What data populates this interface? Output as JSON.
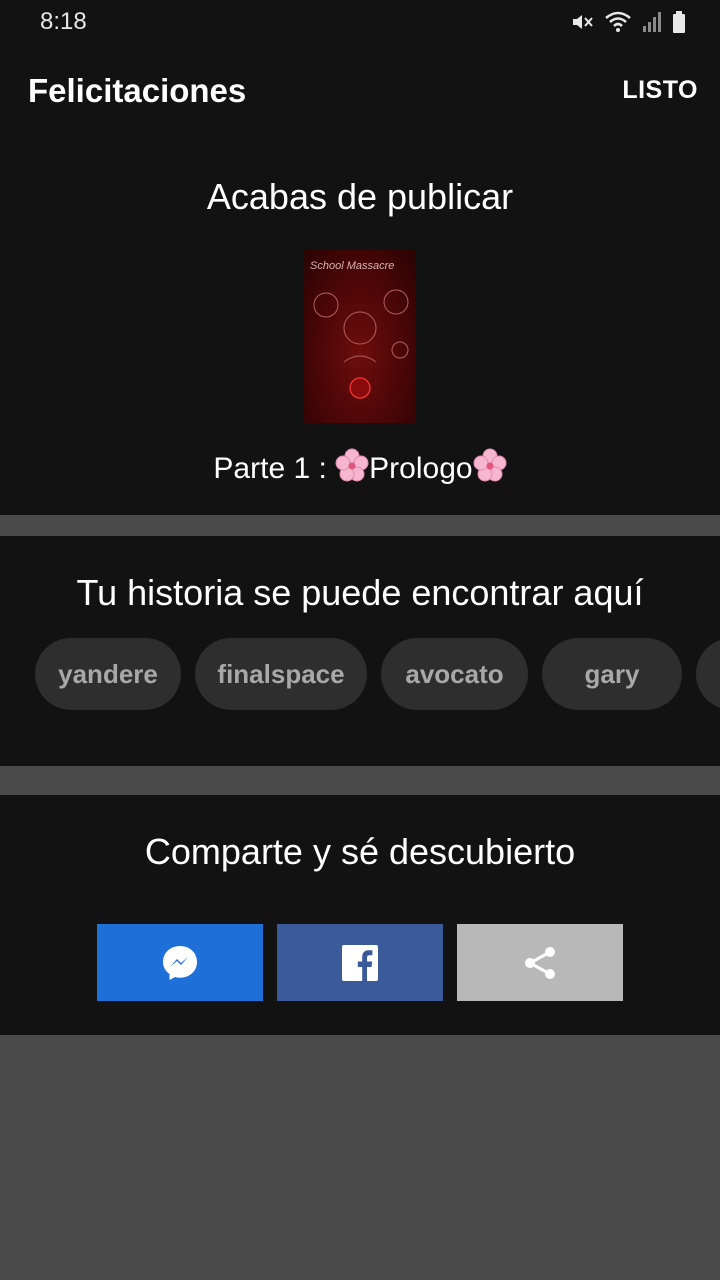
{
  "status_bar": {
    "time": "8:18",
    "icons": [
      "mute-icon",
      "wifi-icon",
      "signal-icon",
      "battery-icon"
    ]
  },
  "app_bar": {
    "title": "Felicitaciones",
    "done_label": "LISTO"
  },
  "published": {
    "heading": "Acabas de publicar",
    "cover_title": "School Massacre",
    "part_label": "Parte 1 : ",
    "part_name": "Prologo"
  },
  "tags_section": {
    "heading": "Tu historia se puede encontrar aquí",
    "tags": [
      "yandere",
      "finalspace",
      "avocato",
      "gary",
      ""
    ]
  },
  "share_section": {
    "heading": "Comparte y sé descubierto",
    "buttons": [
      "messenger-icon",
      "facebook-icon",
      "share-icon"
    ]
  },
  "colors": {
    "background": "#121212",
    "divider": "#4a4a4a",
    "tag": "#2e2e2e",
    "messenger": "#1f6fd8",
    "facebook": "#3a5a9a",
    "share": "#b8b8b8"
  }
}
